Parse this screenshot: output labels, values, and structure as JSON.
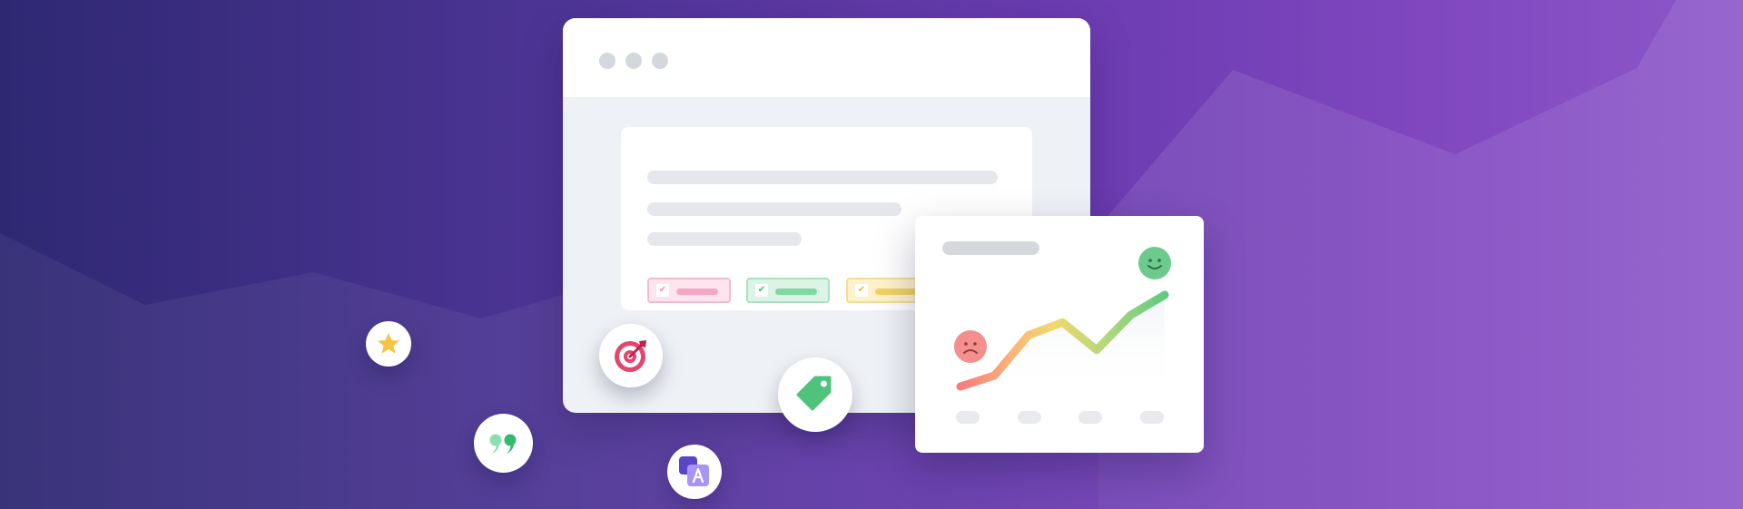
{
  "scene": {
    "description_free": true,
    "gradient_colors": [
      "#2e2872",
      "#4b3493",
      "#6a3bb0",
      "#8047bf",
      "#8d58c9"
    ]
  },
  "browser_window": {
    "dot_color": "#d3d8df",
    "tags": [
      {
        "color": "pink",
        "accent": "#f6a6c4",
        "checked": true
      },
      {
        "color": "green",
        "accent": "#7fd9a0",
        "checked": true
      },
      {
        "color": "yellow",
        "accent": "#f3d161",
        "checked": true
      }
    ],
    "check_glyph": "✔"
  },
  "chart_card": {
    "faces": [
      "happy-face-icon",
      "sad-face-icon"
    ],
    "line_gradient": [
      "#f97b7b",
      "#fbc97a",
      "#f1d96d",
      "#b7d77a",
      "#5ccb82"
    ]
  },
  "chart_data": {
    "type": "line",
    "title": "",
    "xlabel": "",
    "ylabel": "",
    "series": [
      {
        "values": [
          0.0,
          0.12,
          0.56,
          0.7,
          0.4,
          0.78,
          1.0
        ]
      }
    ],
    "ylim": [
      0,
      1
    ],
    "grid": false
  },
  "floating_icons": [
    {
      "icon": "star-icon",
      "color": "#f5c542"
    },
    {
      "icon": "target-icon",
      "color": "#e5456e"
    },
    {
      "icon": "price-tag-icon",
      "color": "#4fc27b"
    },
    {
      "icon": "quote-icon",
      "color": "#46c37d"
    },
    {
      "icon": "translate-icon",
      "color": "#7c64e8"
    }
  ]
}
